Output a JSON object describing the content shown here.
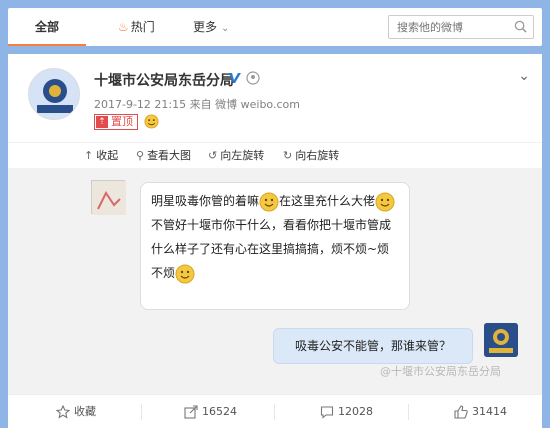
{
  "tabs": {
    "all": "全部",
    "hot": "热门",
    "more": "更多"
  },
  "search": {
    "placeholder": "搜索他的微博"
  },
  "post": {
    "username": "十堰市公安局东岳分局",
    "timestamp": "2017-9-12 21:15",
    "source_prefix": "来自",
    "source": "微博 weibo.com",
    "pinned_label": "置顶"
  },
  "media_bar": {
    "collapse": "收起",
    "view_large": "查看大图",
    "rotate_left": "向左旋转",
    "rotate_right": "向右旋转"
  },
  "image_content": {
    "bubble1_part1": "明星吸毒你管的着嘛",
    "bubble1_part2": "在这里充什么大佬",
    "bubble1_part3": "不管好十堰市你干什么，看看你把十堰市管成什么样子了还有心在这里搞搞搞，烦不烦~烦不烦",
    "bubble2": "吸毒公安不能管，那谁来管？",
    "watermark": "@十堰市公安局东岳分局"
  },
  "actions": {
    "favorite": "收藏",
    "share_count": "16524",
    "comment_count": "12028",
    "like_count": "31414"
  },
  "colors": {
    "background": "#8fb5e6",
    "accent": "#fa7d3c",
    "pin_red": "#e24c4c",
    "verified_blue": "#2e79d0"
  }
}
